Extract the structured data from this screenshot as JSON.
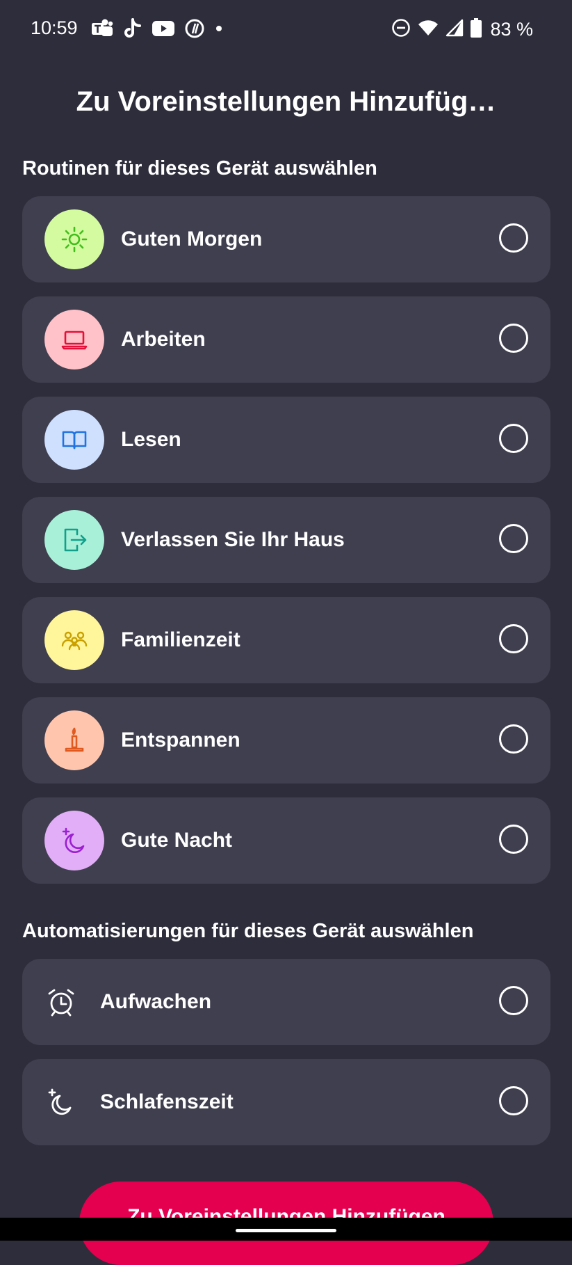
{
  "status_bar": {
    "time": "10:59",
    "battery": "83 %",
    "app_icons": [
      "teams-icon",
      "tiktok-icon",
      "youtube-icon",
      "threads-icon",
      "more-dot-icon"
    ],
    "system_icons": [
      "dnd-icon",
      "wifi-icon",
      "signal-icon",
      "battery-icon"
    ]
  },
  "title": "Zu Voreinstellungen Hinzufüg…",
  "routines": {
    "heading": "Routinen für dieses Gerät auswählen",
    "items": [
      {
        "label": "Guten Morgen",
        "icon": "sun-icon",
        "bg": "#d4fba0",
        "fg": "#3fbf1a"
      },
      {
        "label": "Arbeiten",
        "icon": "laptop-icon",
        "bg": "#ffc2c8",
        "fg": "#e5103a"
      },
      {
        "label": "Lesen",
        "icon": "book-icon",
        "bg": "#cfe0ff",
        "fg": "#1f73e0"
      },
      {
        "label": "Verlassen Sie Ihr Haus",
        "icon": "exit-door-icon",
        "bg": "#a9f0d9",
        "fg": "#12a08a"
      },
      {
        "label": "Familienzeit",
        "icon": "family-icon",
        "bg": "#fff59a",
        "fg": "#c9a000"
      },
      {
        "label": "Entspannen",
        "icon": "candle-icon",
        "bg": "#ffc6ad",
        "fg": "#e05a1f"
      },
      {
        "label": "Gute Nacht",
        "icon": "moon-star-icon",
        "bg": "#e3aef8",
        "fg": "#9a1fd0"
      }
    ]
  },
  "automations": {
    "heading": "Automatisierungen für dieses Gerät auswählen",
    "items": [
      {
        "label": "Aufwachen",
        "icon": "alarm-clock-icon"
      },
      {
        "label": "Schlafenszeit",
        "icon": "moon-star-icon"
      }
    ]
  },
  "cta": {
    "label": "Zu Voreinstellungen Hinzufügen"
  },
  "colors": {
    "background": "#2e2d3b",
    "card": "#403f4f",
    "accent": "#e5004f"
  }
}
